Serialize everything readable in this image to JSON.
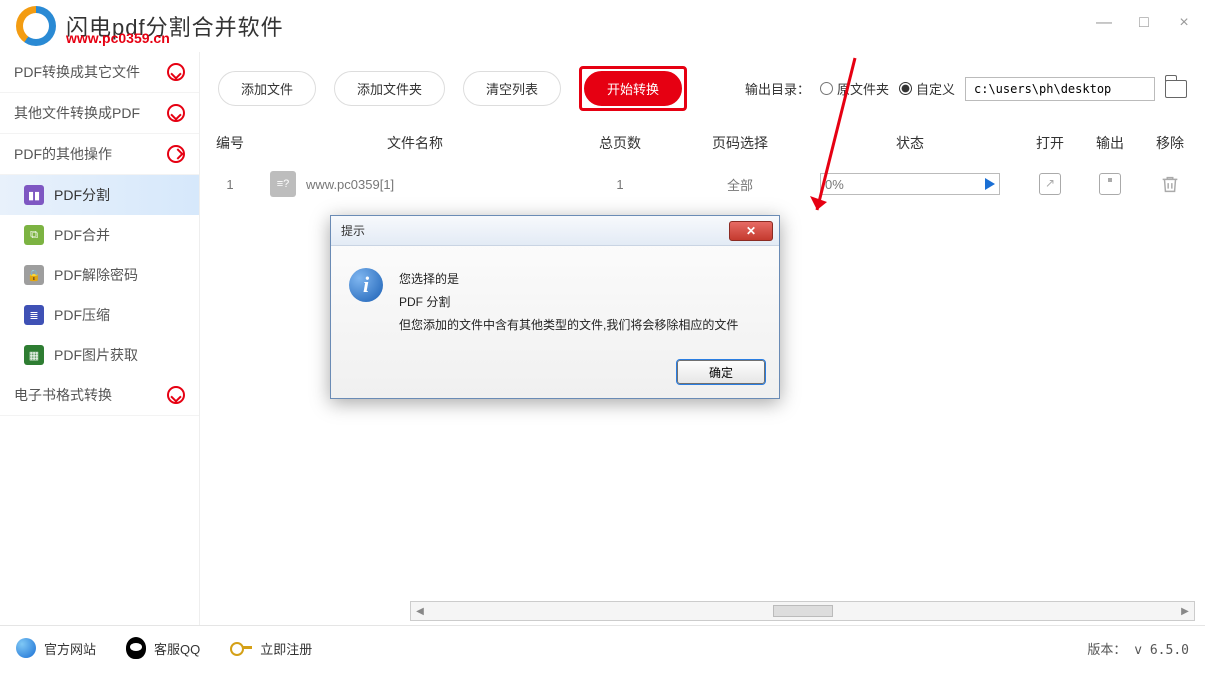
{
  "app_title": "闪电pdf分割合并软件",
  "watermark": "www.pc0359.cn",
  "window_controls": {
    "min": "—",
    "max": "□",
    "close": "×"
  },
  "sidebar": {
    "cats": [
      {
        "label": "PDF转换成其它文件",
        "expanded": false
      },
      {
        "label": "其他文件转换成PDF",
        "expanded": false
      },
      {
        "label": "PDF的其他操作",
        "expanded": true
      },
      {
        "label": "电子书格式转换",
        "expanded": false
      }
    ],
    "items": [
      {
        "label": "PDF分割",
        "color": "#7e57c2",
        "active": true
      },
      {
        "label": "PDF合并",
        "color": "#7cb342"
      },
      {
        "label": "PDF解除密码",
        "color": "#9e9e9e"
      },
      {
        "label": "PDF压缩",
        "color": "#3f51b5"
      },
      {
        "label": "PDF图片获取",
        "color": "#2e7d32"
      }
    ]
  },
  "toolbar": {
    "add_file": "添加文件",
    "add_folder": "添加文件夹",
    "clear_list": "清空列表",
    "start": "开始转换",
    "output_label": "输出目录：",
    "radio_source": "原文件夹",
    "radio_custom": "自定义",
    "output_path": "c:\\users\\ph\\desktop"
  },
  "table": {
    "headers": {
      "num": "编号",
      "name": "文件名称",
      "pages": "总页数",
      "range": "页码选择",
      "status": "状态",
      "open": "打开",
      "out": "输出",
      "del": "移除"
    },
    "rows": [
      {
        "num": "1",
        "name": "www.pc0359[1]",
        "pages": "1",
        "range": "全部",
        "status": "0%"
      }
    ]
  },
  "dialog": {
    "title": "提示",
    "line1": "您选择的是",
    "line2": "PDF 分割",
    "line3": "但您添加的文件中含有其他类型的文件,我们将会移除相应的文件",
    "ok": "确定"
  },
  "footer": {
    "site": "官方网站",
    "qq": "客服QQ",
    "register": "立即注册",
    "version": "版本： v 6.5.0"
  }
}
